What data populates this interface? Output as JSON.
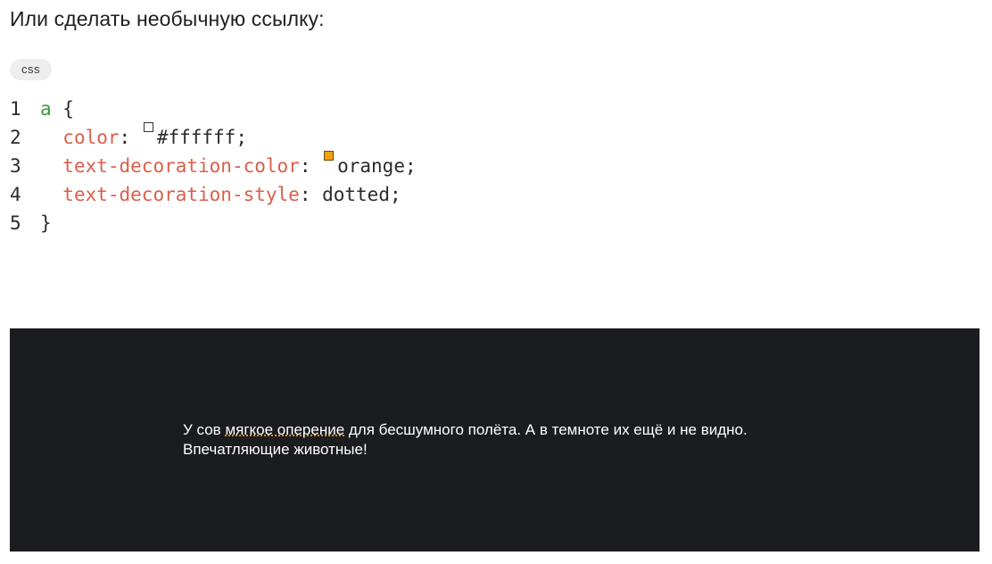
{
  "intro_text": "Или сделать необычную ссылку:",
  "code_block": {
    "language": "css",
    "lines": [
      {
        "number": "1",
        "selector": "a",
        "brace": " {"
      },
      {
        "number": "2",
        "property": "color",
        "colon": ": ",
        "value": "#ffffff",
        "semicolon": ";"
      },
      {
        "number": "3",
        "property": "text-decoration-color",
        "colon": ": ",
        "value": "orange",
        "semicolon": ";"
      },
      {
        "number": "4",
        "property": "text-decoration-style",
        "colon": ": ",
        "value": "dotted",
        "semicolon": ";"
      },
      {
        "number": "5",
        "brace": "}"
      }
    ],
    "colors": {
      "selector": "#3a9a3a",
      "property": "#d95f4b",
      "swatch_white": "#ffffff",
      "swatch_orange": "#f0a012"
    }
  },
  "demo": {
    "background": "#1b1c20",
    "text_before": "У сов ",
    "link_text": "мягкое оперение",
    "text_after": " для бесшумного полёта. А в темноте их ещё и не видно. Впечатляющие животные!"
  }
}
